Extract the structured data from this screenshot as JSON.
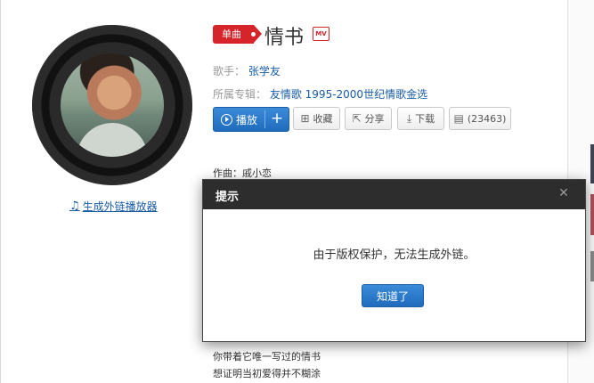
{
  "song": {
    "type_tag": "单曲",
    "title": "情书",
    "mv_badge": "MV",
    "singer_label": "歌手：",
    "singer": "张学友",
    "album_label": "所属专辑：",
    "album": "友情歌 1995-2000世纪情歌金选"
  },
  "actions": {
    "play": "播放",
    "add": "+",
    "collect": "收藏",
    "share": "分享",
    "download": "下载",
    "comments": "(23463)"
  },
  "player_link": "生成外链播放器",
  "lyrics": {
    "composer": "作曲：戚小恋",
    "lines": [
      "你带着它唯一写过的情书",
      "想证明当初爱得并不糊涂"
    ]
  },
  "dialog": {
    "title": "提示",
    "message": "由于版权保护，无法生成外链。",
    "ok": "知道了",
    "close_icon": "close-icon"
  },
  "colors": {
    "accent_red": "#d6242b",
    "link_blue": "#1a5ca8",
    "button_blue": "#1f6bbd",
    "dialog_header": "#2d2d2d"
  }
}
